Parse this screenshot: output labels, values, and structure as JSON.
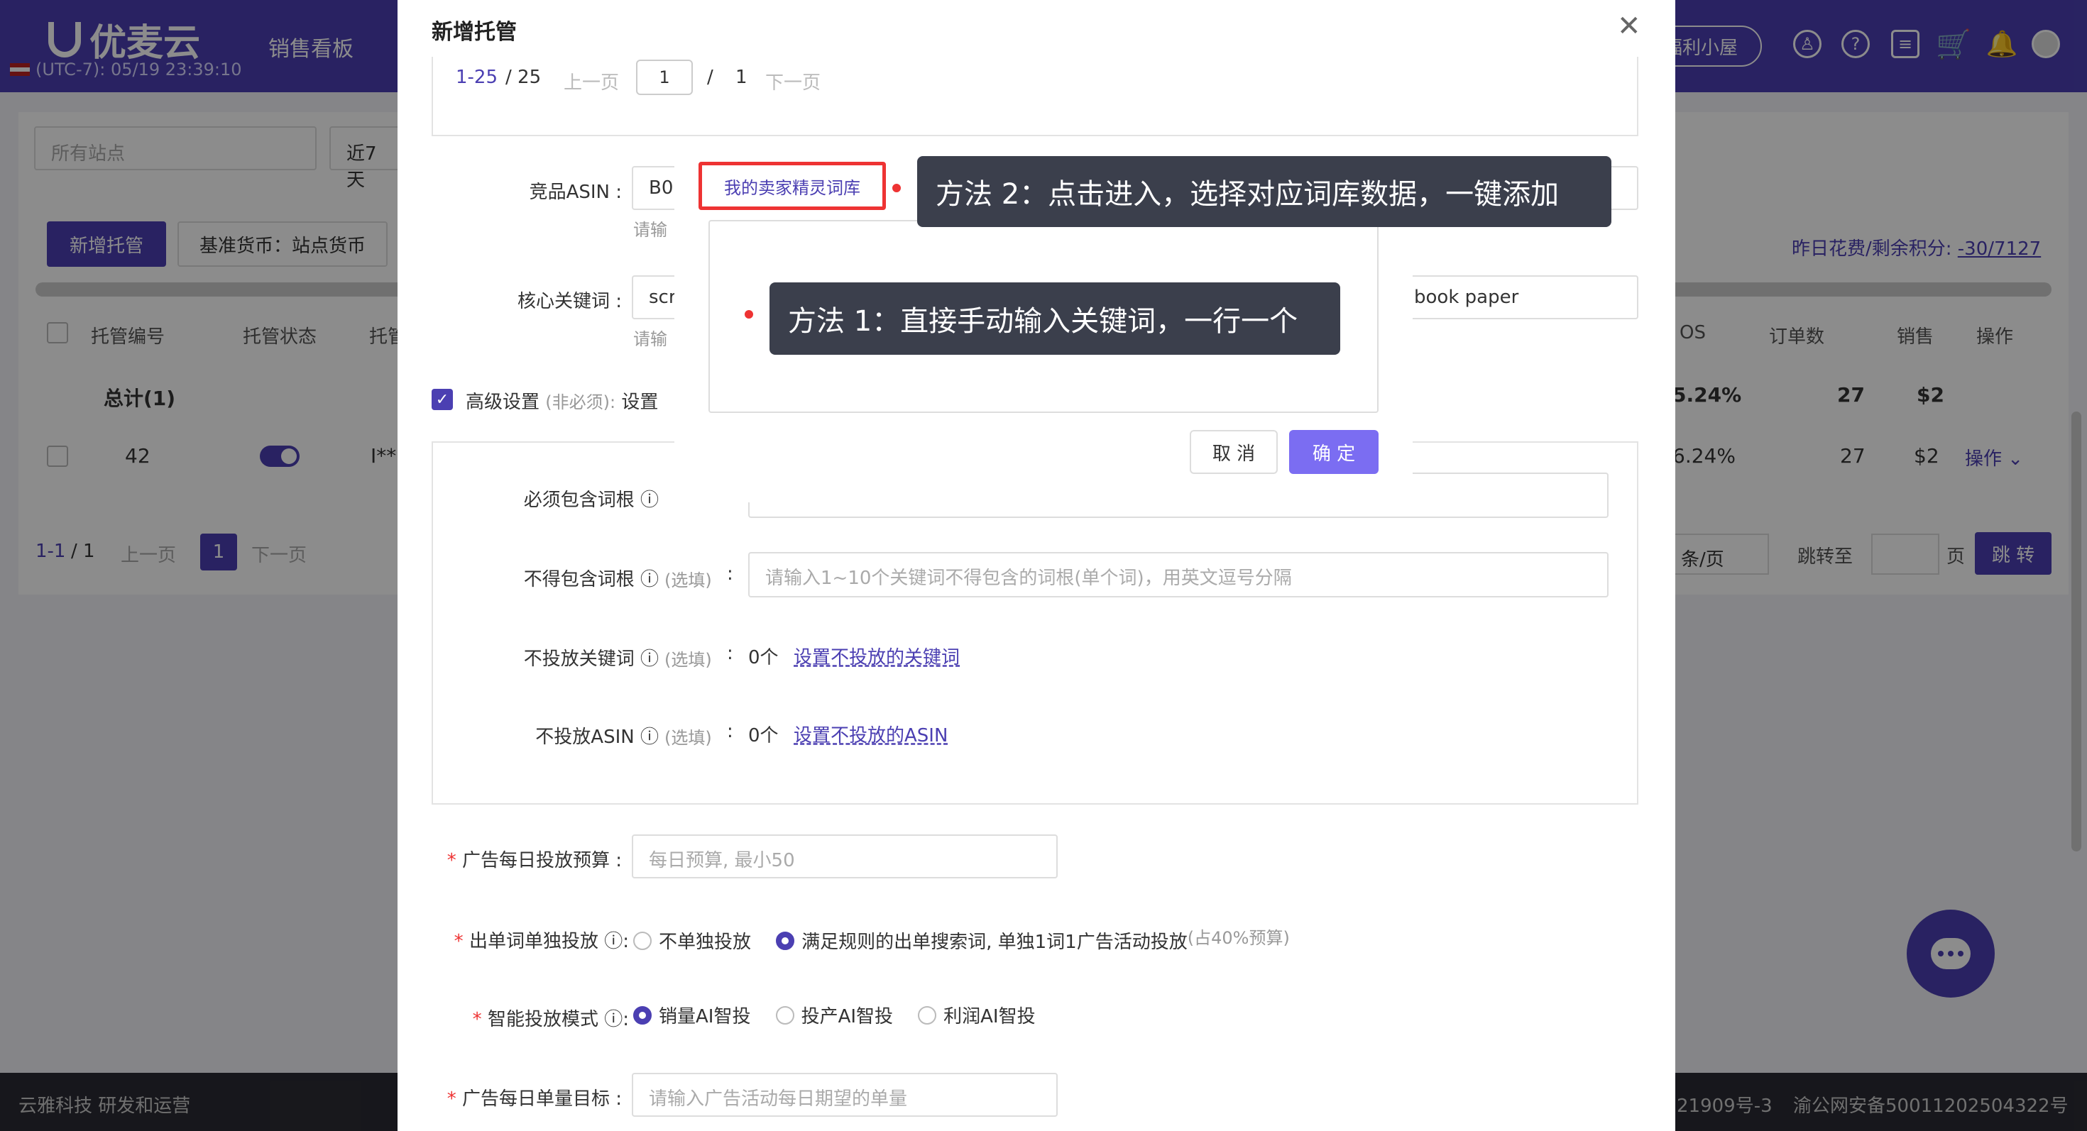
{
  "app": {
    "logo_text": "优麦云",
    "timezone": "(UTC-7): 05/19 23:39:10",
    "nav_sales": "销售看板",
    "welfare": "福利小屋"
  },
  "background": {
    "site_select": "所有站点",
    "date_select": "近7天",
    "new_button": "新增托管",
    "currency_button": "基准货币：站点货币",
    "spend_label": "昨日花费/剩余积分:",
    "spend_value": "-30/7127",
    "columns": [
      "托管编号",
      "托管状态",
      "托管",
      "OS",
      "订单数",
      "销售",
      "操作"
    ],
    "total_label": "总计(1)",
    "total_acos": "5.24%",
    "total_orders": "27",
    "total_sales": "$2",
    "row_id": "42",
    "row_name": "I**",
    "row_acos": "6.24%",
    "row_orders": "27",
    "row_sales": "$2",
    "row_op": "操作",
    "pager_range": "1-1",
    "pager_total": "/ 1",
    "pager_prev": "上一页",
    "pager_page": "1",
    "pager_next": "下一页",
    "page_size": "条/页",
    "jump_to": "跳转至",
    "page_unit": "页",
    "jump_button": "跳 转",
    "footer_left": "云雅科技 研发和运营",
    "footer_right_1": "21909号-3",
    "footer_right_2": "渝公网安备50011202504322号"
  },
  "drawer": {
    "title": "新增托管",
    "pager_range": "1-25",
    "pager_total": "/ 25",
    "pager_prev": "上一页",
    "pager_input": "1",
    "pager_slash": "/",
    "pager_pages": "1",
    "pager_next": "下一页",
    "asin_label": "竞品ASIN :",
    "asin_value": "B0",
    "asin_hint": "请输",
    "keyword_label": "核心关键词 :",
    "keyword_value": "scr",
    "keyword_value_right": "book paper",
    "keyword_hint": "请输",
    "advanced_label": "高级设置",
    "advanced_optional": "(非必须):",
    "advanced_suffix": "设置",
    "must_include_label": "必须包含词根",
    "exclude_root_label": "不得包含词根",
    "exclude_root_placeholder": "请输入1~10个关键词不得包含的词根(单个词)，用英文逗号分隔",
    "no_keyword_label": "不投放关键词",
    "no_keyword_count": "0个",
    "no_keyword_link": "设置不投放的关键词",
    "no_asin_label": "不投放ASIN",
    "no_asin_count": "0个",
    "no_asin_link": "设置不投放的ASIN",
    "optional": "(选填)",
    "colon": ":",
    "budget_label": "广告每日投放预算 :",
    "budget_placeholder": "每日预算, 最小50",
    "single_label": "出单词单独投放",
    "single_opt1": "不单独投放",
    "single_opt2": "满足规则的出单搜索词, 单独1词1广告活动投放",
    "single_opt2_note": "(占40%预算)",
    "mode_label": "智能投放模式",
    "mode_opt1": "销量AI智投",
    "mode_opt2": "投产AI智投",
    "mode_opt3": "利润AI智投",
    "target_label": "广告每日单量目标 :",
    "target_placeholder": "请输入广告活动每日期望的单量"
  },
  "dialog": {
    "library_button": "我的卖家精灵词库",
    "cancel": "取 消",
    "ok": "确 定"
  },
  "callouts": {
    "method2": "方法 2：点击进入，选择对应词库数据，一键添加",
    "method1": "方法 1：直接手动输入关键词，一行一个"
  },
  "colors": {
    "primary": "#4b3fb2",
    "highlight_border": "#e33333",
    "callout_bg": "#3b3f4c"
  }
}
